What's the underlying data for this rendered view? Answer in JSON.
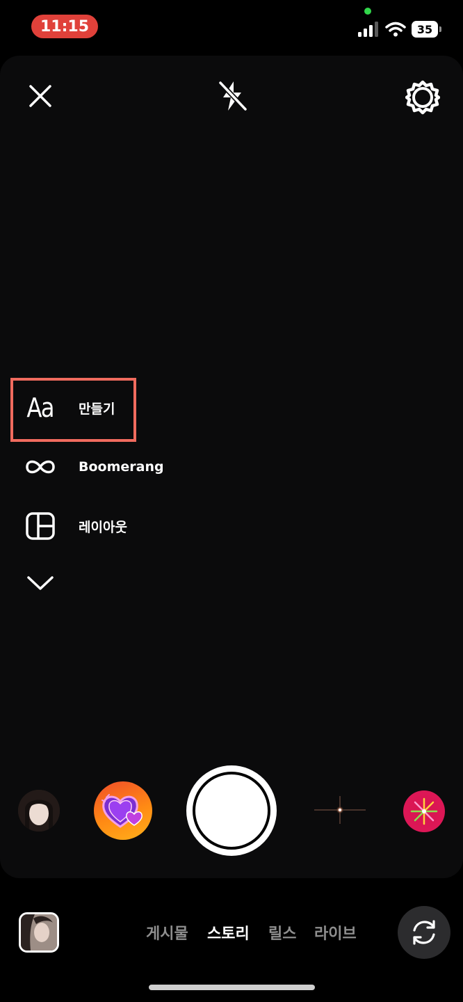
{
  "status_bar": {
    "time": "11:15",
    "battery": "35",
    "icons": [
      "privacy-dot",
      "signal-icon",
      "wifi-icon",
      "battery-icon"
    ]
  },
  "camera": {
    "top_controls": {
      "close_icon": "close-icon",
      "flash_icon": "flash-off-icon",
      "settings_icon": "settings-gear-icon"
    },
    "side_menu": {
      "items": [
        {
          "icon": "text-aa-icon",
          "icon_text": "Aa",
          "label": "만들기",
          "highlighted": true
        },
        {
          "icon": "infinity-icon",
          "label": "Boomerang"
        },
        {
          "icon": "layout-grid-icon",
          "label": "레이아웃"
        }
      ],
      "expand_icon": "chevron-down-icon"
    },
    "effects": [
      "avatar-effect",
      "heart-effect",
      "shutter-button",
      "sparkle-effect",
      "burst-effect"
    ]
  },
  "bottom_bar": {
    "modes": [
      "게시물",
      "스토리",
      "릴스",
      "라이브"
    ],
    "active_mode": "스토리",
    "flip_icon": "camera-flip-icon"
  },
  "colors": {
    "background": "#000000",
    "viewport": "#0b0b0c",
    "time_pill": "#e0413a",
    "highlight_box": "#f06b5e",
    "inactive_tab": "#8e8e8e"
  }
}
